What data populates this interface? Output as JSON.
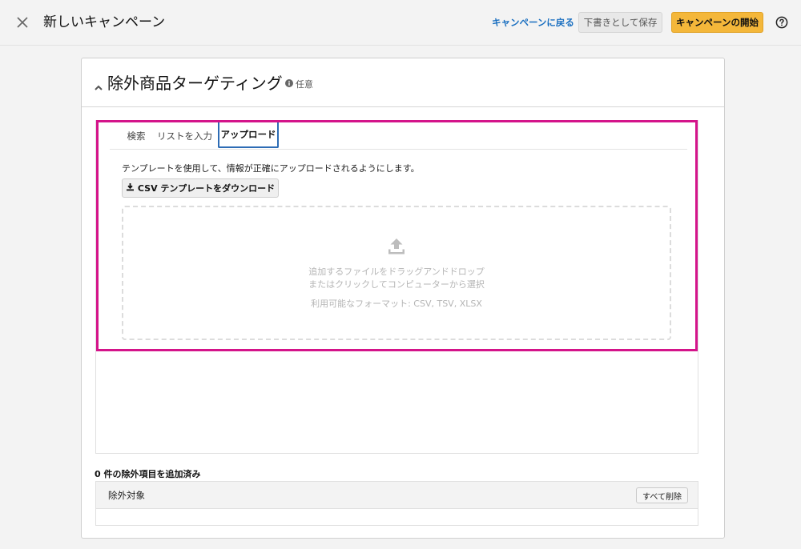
{
  "header": {
    "title": "新しいキャンペーン",
    "back_link": "キャンペーンに戻る",
    "save_draft": "下書きとして保存",
    "start_campaign": "キャンペーンの開始",
    "close_icon": "close-icon",
    "help_icon": "help-circle-icon"
  },
  "section": {
    "title": "除外商品ターゲティング",
    "optional": "任意",
    "info_icon": "info-icon"
  },
  "tabs": [
    {
      "label": "検索",
      "active": false
    },
    {
      "label": "リストを入力",
      "active": false
    },
    {
      "label": "アップロード",
      "active": true
    }
  ],
  "upload": {
    "instructions": "テンプレートを使用して、情報が正確にアップロードされるようにします。",
    "template_button": "CSV テンプレートをダウンロード",
    "drop_line1": "追加するファイルをドラッグアンドドロップ",
    "drop_line2": "またはクリックしてコンピューターから選択",
    "formats": "利用可能なフォーマット: CSV, TSV, XLSX"
  },
  "exclusions": {
    "count_label": "0 件の除外項目を追加済み",
    "column_label": "除外対象",
    "delete_all": "すべて削除"
  },
  "colors": {
    "accent": "#f4b73a",
    "link": "#1a6fc0",
    "highlight": "#d4148a",
    "active_tab": "#2d6cb5"
  }
}
